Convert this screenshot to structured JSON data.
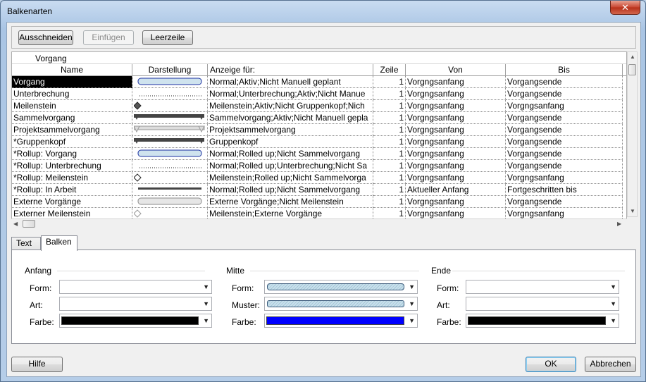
{
  "window": {
    "title": "Balkenarten",
    "close_label": "✕"
  },
  "toolbar": {
    "cut": "Ausschneiden",
    "paste": "Einfügen",
    "blank_row": "Leerzeile"
  },
  "grid": {
    "group_label": "Vorgang",
    "headers": [
      "Name",
      "Darstellung",
      "Anzeige für:",
      "Zeile",
      "Von",
      "Bis"
    ],
    "rows": [
      {
        "name": "Vorgang",
        "shape": "bar",
        "show": "Normal;Aktiv;Nicht Manuell geplant",
        "line": "1",
        "from": "Vorgngsanfang",
        "to": "Vorgangsende"
      },
      {
        "name": "Unterbrechung",
        "shape": "dots",
        "show": "Normal;Unterbrechung;Aktiv;Nicht Manue",
        "line": "1",
        "from": "Vorgngsanfang",
        "to": "Vorgangsende"
      },
      {
        "name": "Meilenstein",
        "shape": "diamond-filled",
        "show": "Meilenstein;Aktiv;Nicht Gruppenkopf;Nich",
        "line": "1",
        "from": "Vorgngsanfang",
        "to": "Vorgngsanfang"
      },
      {
        "name": "Sammelvorgang",
        "shape": "summary",
        "show": "Sammelvorgang;Aktiv;Nicht Manuell gepla",
        "line": "1",
        "from": "Vorgngsanfang",
        "to": "Vorgangsende"
      },
      {
        "name": "Projektsammelvorgang",
        "shape": "summary-gray",
        "show": "Projektsammelvorgang",
        "line": "1",
        "from": "Vorgngsanfang",
        "to": "Vorgangsende"
      },
      {
        "name": "*Gruppenkopf",
        "shape": "summary",
        "show": "Gruppenkopf",
        "line": "1",
        "from": "Vorgngsanfang",
        "to": "Vorgangsende"
      },
      {
        "name": "*Rollup: Vorgang",
        "shape": "bar",
        "show": "Normal;Rolled up;Nicht Sammelvorgang",
        "line": "1",
        "from": "Vorgngsanfang",
        "to": "Vorgangsende"
      },
      {
        "name": "*Rollup: Unterbrechung",
        "shape": "dots",
        "show": "Normal;Rolled up;Unterbrechung;Nicht Sa",
        "line": "1",
        "from": "Vorgngsanfang",
        "to": "Vorgangsende"
      },
      {
        "name": "*Rollup: Meilenstein",
        "shape": "diamond-open",
        "show": "Meilenstein;Rolled up;Nicht Sammelvorga",
        "line": "1",
        "from": "Vorgngsanfang",
        "to": "Vorgngsanfang"
      },
      {
        "name": "*Rollup: In Arbeit",
        "shape": "thin-bar",
        "show": "Normal;Rolled up;Nicht Sammelvorgang",
        "line": "1",
        "from": "Aktueller Anfang",
        "to": "Fortgeschritten bis"
      },
      {
        "name": "Externe Vorgänge",
        "shape": "bar-gray",
        "show": "Externe Vorgänge;Nicht Meilenstein",
        "line": "1",
        "from": "Vorgngsanfang",
        "to": "Vorgangsende"
      },
      {
        "name": "Externer Meilenstein",
        "shape": "diamond-gray",
        "show": "Meilenstein;Externe Vorgänge",
        "line": "1",
        "from": "Vorgngsanfang",
        "to": "Vorgngsanfang"
      }
    ]
  },
  "tabs": [
    "Text",
    "Balken"
  ],
  "active_tab": "Balken",
  "panel": {
    "start": {
      "title": "Anfang",
      "shape_label": "Form:",
      "type_label": "Art:",
      "color_label": "Farbe:",
      "color": "#000000"
    },
    "middle": {
      "title": "Mitte",
      "shape_label": "Form:",
      "pattern_label": "Muster:",
      "color_label": "Farbe:",
      "color": "#0000ff"
    },
    "end": {
      "title": "Ende",
      "shape_label": "Form:",
      "type_label": "Art:",
      "color_label": "Farbe:",
      "color": "#000000"
    }
  },
  "footer": {
    "help": "Hilfe",
    "ok": "OK",
    "cancel": "Abbrechen"
  }
}
